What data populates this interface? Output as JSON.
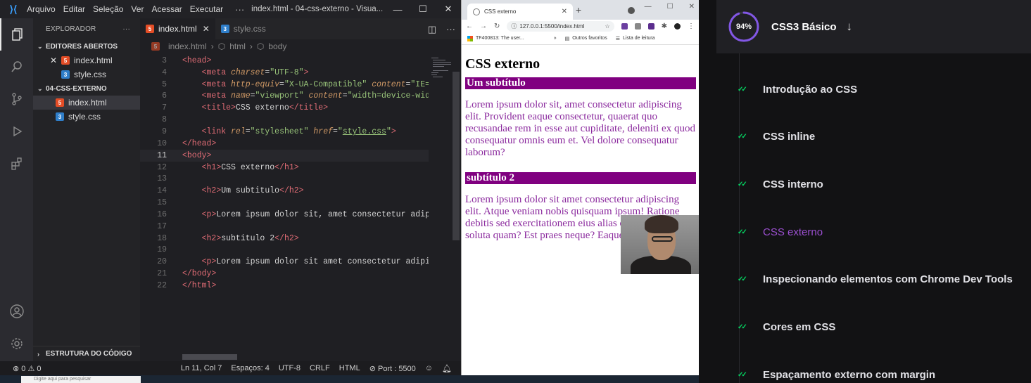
{
  "vscode": {
    "menu": [
      "Arquivo",
      "Editar",
      "Seleção",
      "Ver",
      "Acessar",
      "Executar"
    ],
    "more": "···",
    "window_title": "index.html - 04-css-externo - Visua...",
    "explorer_title": "EXPLORADOR",
    "explorer_more": "···",
    "open_editors_label": "EDITORES ABERTOS",
    "open_editors": [
      {
        "name": "index.html",
        "type": "html"
      },
      {
        "name": "style.css",
        "type": "css"
      }
    ],
    "folder_label": "04-CSS-EXTERNO",
    "folder_files": [
      {
        "name": "index.html",
        "type": "html"
      },
      {
        "name": "style.css",
        "type": "css"
      }
    ],
    "outline_label": "ESTRUTURA DO CÓDIGO",
    "tabs": [
      {
        "label": "index.html",
        "type": "html",
        "active": true
      },
      {
        "label": "style.css",
        "type": "css",
        "active": false
      }
    ],
    "breadcrumb": [
      "index.html",
      "html",
      "body"
    ],
    "code_lines": [
      {
        "n": "3",
        "html": "<span class=\"tg\">&lt;head&gt;</span>"
      },
      {
        "n": "4",
        "html": "    <span class=\"tg\">&lt;meta</span> <span class=\"at\">charset</span>=<span class=\"st\">\"UTF-8\"</span><span class=\"tg\">&gt;</span>"
      },
      {
        "n": "5",
        "html": "    <span class=\"tg\">&lt;meta</span> <span class=\"at\">http-equiv</span>=<span class=\"st\">\"X-UA-Compatible\"</span> <span class=\"at\">content</span>=<span class=\"st\">\"IE=</span>"
      },
      {
        "n": "6",
        "html": "    <span class=\"tg\">&lt;meta</span> <span class=\"at\">name</span>=<span class=\"st\">\"viewport\"</span> <span class=\"at\">content</span>=<span class=\"st\">\"width=device-wid</span>"
      },
      {
        "n": "7",
        "html": "    <span class=\"tg\">&lt;title&gt;</span>CSS externo<span class=\"tg\">&lt;/title&gt;</span>"
      },
      {
        "n": "8",
        "html": ""
      },
      {
        "n": "9",
        "html": "    <span class=\"tg\">&lt;link</span> <span class=\"at\">rel</span>=<span class=\"st\">\"stylesheet\"</span> <span class=\"at\">href</span>=<span class=\"st\">\"<u>style.css</u>\"</span><span class=\"tg\">&gt;</span>"
      },
      {
        "n": "10",
        "html": "<span class=\"tg\">&lt;/head&gt;</span>"
      },
      {
        "n": "11",
        "html": "<span class=\"tg\">&lt;body&gt;</span>",
        "current": true
      },
      {
        "n": "12",
        "html": "    <span class=\"tg\">&lt;h1&gt;</span>CSS externo<span class=\"tg\">&lt;/h1&gt;</span>"
      },
      {
        "n": "13",
        "html": ""
      },
      {
        "n": "14",
        "html": "    <span class=\"tg\">&lt;h2&gt;</span>Um subtitulo<span class=\"tg\">&lt;/h2&gt;</span>"
      },
      {
        "n": "15",
        "html": ""
      },
      {
        "n": "16",
        "html": "    <span class=\"tg\">&lt;p&gt;</span>Lorem ipsum dolor sit, amet consectetur adip"
      },
      {
        "n": "17",
        "html": ""
      },
      {
        "n": "18",
        "html": "    <span class=\"tg\">&lt;h2&gt;</span>subtitulo 2<span class=\"tg\">&lt;/h2&gt;</span>"
      },
      {
        "n": "19",
        "html": ""
      },
      {
        "n": "20",
        "html": "    <span class=\"tg\">&lt;p&gt;</span>Lorem ipsum dolor sit amet consectetur adipi"
      },
      {
        "n": "21",
        "html": "<span class=\"tg\">&lt;/body&gt;</span>"
      },
      {
        "n": "22",
        "html": "<span class=\"tg\">&lt;/html&gt;</span>"
      }
    ],
    "status": {
      "problems": "⊗ 0 ⚠ 0",
      "position": "Ln 11, Col 7",
      "spaces": "Espaços: 4",
      "encoding": "UTF-8",
      "eol": "CRLF",
      "language": "HTML",
      "port": "⊘ Port : 5500"
    },
    "taskbar_search": "Digite aqui para pesquisar"
  },
  "chrome": {
    "tab_title": "CSS externo",
    "url": "127.0.0.1:5500/index.html",
    "bookmarks": [
      "TF400813: The user...",
      "»",
      "Outros favoritos",
      "Lista de leitura"
    ],
    "page": {
      "h1": "CSS externo",
      "h2_1": "Um subtítulo",
      "p1": "Lorem ipsum dolor sit, amet consectetur adipiscing elit. Provident eaque consectetur, quaerat quo recusandae rem in esse aut cupiditate, deleniti ex quod consequatur omnis eum et. Vel dolore consequatur laborum?",
      "h2_2": "subtítulo 2",
      "p2": "Lorem ipsum dolor sit amet consectetur adipiscing elit. Atque veniam nobis quisquam ipsum! Ratione debitis sed exercitationem eius alias o officiis officia soluta quam? Est praes neque? Eaque?"
    }
  },
  "course": {
    "progress": 0.94,
    "progress_label": "94%",
    "title": "CSS3 Básico",
    "accent": "#8257e5",
    "check_color": "#04d361",
    "lessons": [
      {
        "title": "Introdução ao CSS",
        "done": true,
        "active": false
      },
      {
        "title": "CSS inline",
        "done": true,
        "active": false
      },
      {
        "title": "CSS interno",
        "done": true,
        "active": false
      },
      {
        "title": "CSS externo",
        "done": true,
        "active": true
      },
      {
        "title": "Inspecionando elementos com Chrome Dev Tools",
        "done": true,
        "active": false
      },
      {
        "title": "Cores em CSS",
        "done": true,
        "active": false
      },
      {
        "title": "Espaçamento externo com margin",
        "done": true,
        "active": false
      }
    ]
  }
}
